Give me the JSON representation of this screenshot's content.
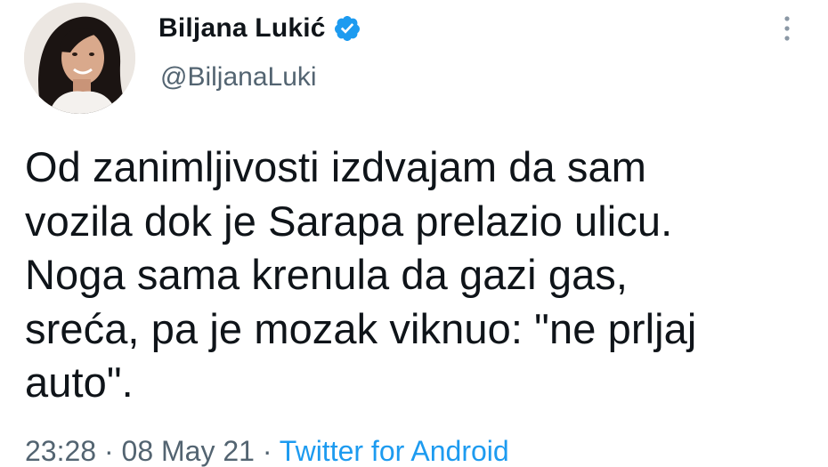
{
  "author": {
    "display_name": "Biljana Lukić",
    "handle": "@BiljanaLuki",
    "verified": true,
    "avatar_icon": "profile-photo"
  },
  "tweet": {
    "text": "Od zanimljivosti izdvajam da sam\nvozila dok je Sarapa prelazio ulicu.\nNoga sama krenula da gazi gas,\nsreća, pa je mozak viknuo: \"ne prljaj\nauto\".",
    "time": "23:28",
    "separator": " · ",
    "date": "08 May 21",
    "source": "Twitter for Android"
  },
  "icons": {
    "verified": "verified-badge-icon",
    "more": "more-options-icon"
  },
  "colors": {
    "text": "#0f1419",
    "secondary": "#536471",
    "accent": "#1d9bf0"
  }
}
